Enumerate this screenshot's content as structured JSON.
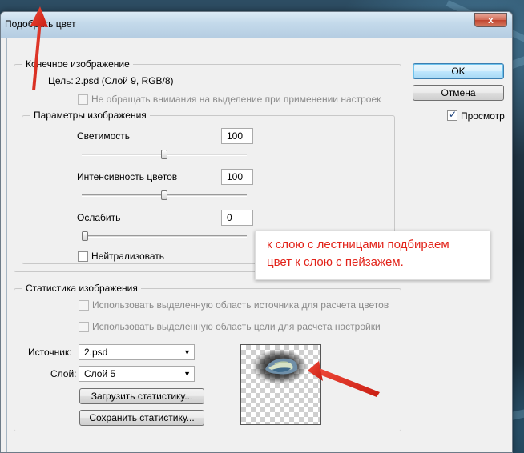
{
  "window": {
    "title": "Подобрать цвет",
    "close_glyph": "x"
  },
  "target_group": {
    "legend": "Конечное изображение",
    "target_label": "Цель:",
    "target_value": "2.psd (Слой 9, RGB/8)",
    "ignore_selection_label": "Не обращать внимания на выделение при применении настроек"
  },
  "options_group": {
    "legend": "Параметры изображения",
    "luminance_label": "Светимость",
    "luminance_value": "100",
    "luminance_level": 0.5,
    "color_intensity_label": "Интенсивность цветов",
    "color_intensity_value": "100",
    "color_intensity_level": 0.5,
    "fade_label": "Ослабить",
    "fade_value": "0",
    "fade_level": 0,
    "neutralize_label": "Нейтрализовать"
  },
  "stats_group": {
    "legend": "Статистика изображения",
    "use_source_selection_label": "Использовать выделенную область источника для расчета цветов",
    "use_target_selection_label": "Использовать выделенную область цели для расчета настройки",
    "source_label": "Источник:",
    "source_value": "2.psd",
    "layer_label": "Слой:",
    "layer_value": "Слой 5",
    "load_stats_label": "Загрузить статистику...",
    "save_stats_label": "Сохранить статистику..."
  },
  "buttons": {
    "ok_label": "OK",
    "cancel_label": "Отмена",
    "preview_label": "Просмотр",
    "preview_checked": true
  },
  "annotation": {
    "line1": "к слою с лестницами подбираем",
    "line2": "цвет к слою с пейзажем.",
    "color": "#e2231a"
  },
  "colors": {
    "accent": "#3c7fb1",
    "annotation_red": "#e2231a"
  }
}
